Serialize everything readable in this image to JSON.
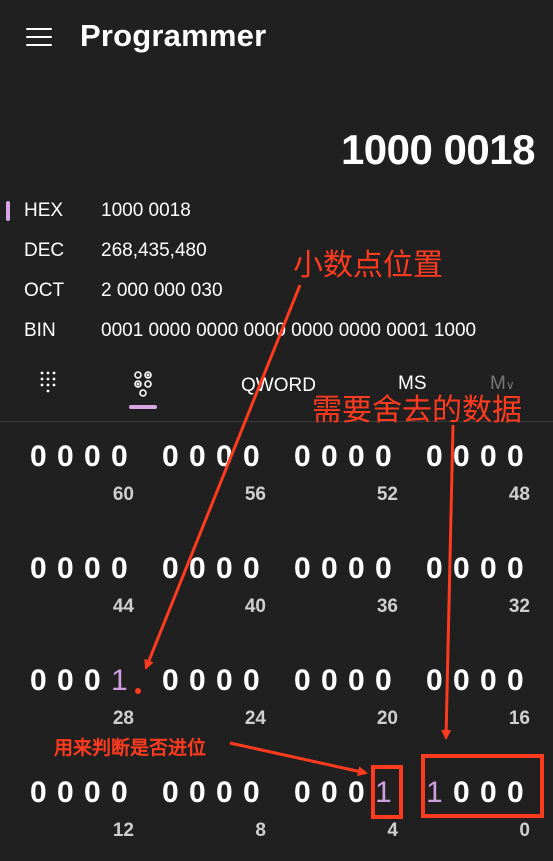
{
  "header": {
    "title": "Programmer",
    "menu_icon": "hamburger-menu-icon"
  },
  "display": {
    "value": "1000 0018"
  },
  "radix": [
    {
      "label": "HEX",
      "value": "1000 0018",
      "selected": true
    },
    {
      "label": "DEC",
      "value": "268,435,480",
      "selected": false
    },
    {
      "label": "OCT",
      "value": "2 000 000 030",
      "selected": false
    },
    {
      "label": "BIN",
      "value": "0001 0000 0000 0000 0000 0000 0001 1000",
      "selected": false
    }
  ],
  "toolbar": {
    "keypad_icon": "full-keypad-icon",
    "bitflip_icon": "bit-toggling-keypad-icon",
    "word_size": "QWORD",
    "ms_label": "MS",
    "m_dropdown_label": "M",
    "m_dropdown_icon": "chevron-down-icon"
  },
  "bit_groups": [
    {
      "bits": [
        "0",
        "0",
        "0",
        "0"
      ],
      "position": "60"
    },
    {
      "bits": [
        "0",
        "0",
        "0",
        "0"
      ],
      "position": "56"
    },
    {
      "bits": [
        "0",
        "0",
        "0",
        "0"
      ],
      "position": "52"
    },
    {
      "bits": [
        "0",
        "0",
        "0",
        "0"
      ],
      "position": "48"
    },
    {
      "bits": [
        "0",
        "0",
        "0",
        "0"
      ],
      "position": "44"
    },
    {
      "bits": [
        "0",
        "0",
        "0",
        "0"
      ],
      "position": "40"
    },
    {
      "bits": [
        "0",
        "0",
        "0",
        "0"
      ],
      "position": "36"
    },
    {
      "bits": [
        "0",
        "0",
        "0",
        "0"
      ],
      "position": "32"
    },
    {
      "bits": [
        "0",
        "0",
        "0",
        "1"
      ],
      "position": "28"
    },
    {
      "bits": [
        "0",
        "0",
        "0",
        "0"
      ],
      "position": "24"
    },
    {
      "bits": [
        "0",
        "0",
        "0",
        "0"
      ],
      "position": "20"
    },
    {
      "bits": [
        "0",
        "0",
        "0",
        "0"
      ],
      "position": "16"
    },
    {
      "bits": [
        "0",
        "0",
        "0",
        "0"
      ],
      "position": "12"
    },
    {
      "bits": [
        "0",
        "0",
        "0",
        "0"
      ],
      "position": "8"
    },
    {
      "bits": [
        "0",
        "0",
        "0",
        "1"
      ],
      "position": "4"
    },
    {
      "bits": [
        "1",
        "0",
        "0",
        "0"
      ],
      "position": "0"
    }
  ],
  "annotations": {
    "decimal_point": "小数点位置",
    "discard_data": "需要舍去的数据",
    "carry_check": "用来判断是否进位",
    "color": "#ff3b1f"
  },
  "colors": {
    "background": "#202020",
    "accent": "#d8a6e6",
    "set_bit": "#cf9fe0"
  }
}
